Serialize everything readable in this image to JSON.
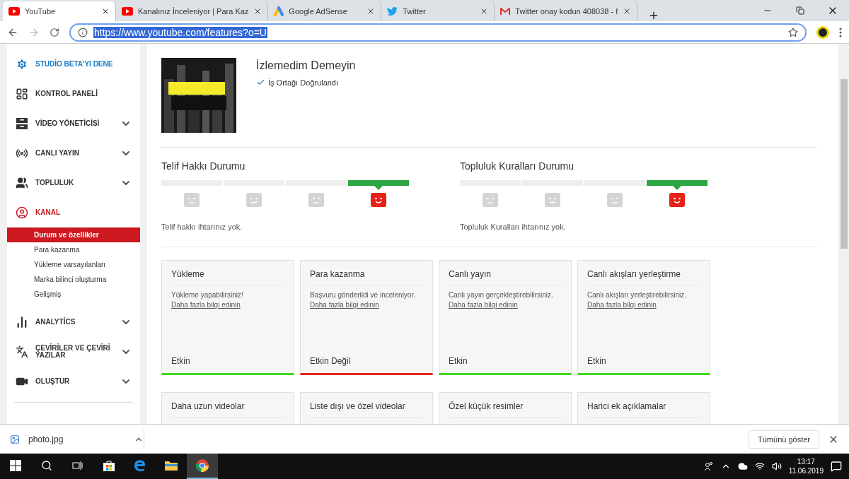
{
  "browser": {
    "tabs": [
      {
        "title": "YouTube",
        "kind": "youtube",
        "selected": true
      },
      {
        "title": "Kanalınız İnceleniyor | Para Kaz",
        "kind": "youtube",
        "selected": false
      },
      {
        "title": "Google AdSense",
        "kind": "adsense",
        "selected": false
      },
      {
        "title": "Twitter",
        "kind": "twitter",
        "selected": false
      },
      {
        "title": "Twitter onay kodun 408038 - f",
        "kind": "gmail",
        "selected": false
      }
    ],
    "address": "https://www.youtube.com/features?o=U"
  },
  "sidebar": {
    "items": [
      {
        "label": "STUDİO BETA'YI DENE",
        "kind": "promo",
        "expandable": false,
        "selected": false
      },
      {
        "label": "KONTROL PANELİ",
        "kind": "dashboard",
        "expandable": false,
        "selected": false
      },
      {
        "label": "VİDEO YÖNETİCİSİ",
        "kind": "videos",
        "expandable": true,
        "selected": false
      },
      {
        "label": "CANLI YAYIN",
        "kind": "live",
        "expandable": true,
        "selected": false
      },
      {
        "label": "TOPLULUK",
        "kind": "community",
        "expandable": true,
        "selected": false
      },
      {
        "label": "KANAL",
        "kind": "channel",
        "expandable": false,
        "selected": true,
        "children": [
          {
            "label": "Durum ve özellikler",
            "selected": true
          },
          {
            "label": "Para kazanma",
            "selected": false
          },
          {
            "label": "Yükleme varsayılanları",
            "selected": false
          },
          {
            "label": "Marka bilinci oluşturma",
            "selected": false
          },
          {
            "label": "Gelişmiş",
            "selected": false
          }
        ]
      },
      {
        "label": "ANALYTİCS",
        "kind": "analytics",
        "expandable": true,
        "selected": false
      },
      {
        "label": "ÇEVİRİLER VE ÇEVİRİ YAZILAR",
        "kind": "translate",
        "expandable": true,
        "selected": false
      },
      {
        "label": "OLUŞTUR",
        "kind": "create",
        "expandable": true,
        "selected": false
      }
    ]
  },
  "channel": {
    "name": "İzlemedim Demeyin",
    "badge": "İş Ortağı Doğrulandı"
  },
  "status_meters": [
    {
      "title": "Telif Hakkı Durumu",
      "segments": [
        {
          "kind": "frown",
          "selected": false
        },
        {
          "kind": "skew",
          "selected": false
        },
        {
          "kind": "flat",
          "selected": false
        },
        {
          "kind": "smile",
          "selected": true
        }
      ],
      "message": "Telif hakkı ihtarınız yok."
    },
    {
      "title": "Topluluk Kuralları Durumu",
      "segments": [
        {
          "kind": "frown",
          "selected": false
        },
        {
          "kind": "skew",
          "selected": false
        },
        {
          "kind": "flat",
          "selected": false
        },
        {
          "kind": "smile",
          "selected": true
        }
      ],
      "message": "Topluluk Kuralları ihtarınız yok."
    }
  ],
  "features": [
    {
      "title": "Yükleme",
      "description": "Yükleme yapabilirsiniz!",
      "link": "Daha fazla bilgi edinin",
      "status": "Etkin",
      "enabled": true
    },
    {
      "title": "Para kazanma",
      "description": "Başvuru gönderildi ve inceleniyor.",
      "link": "Daha fazla bilgi edinin",
      "status": "Etkin Değil",
      "enabled": false
    },
    {
      "title": "Canlı yayın",
      "description": "Canlı yayın gerçekleştirebilirsiniz.",
      "link": "Daha fazla bilgi edinin",
      "status": "Etkin",
      "enabled": true
    },
    {
      "title": "Canlı akışları yerleştirme",
      "description": "Canlı akışları yerleştirebilirsiniz.",
      "link": "Daha fazla bilgi edinin",
      "status": "Etkin",
      "enabled": true
    },
    {
      "title": "Daha uzun videolar"
    },
    {
      "title": "Liste dışı ve özel videolar"
    },
    {
      "title": "Özel küçük resimler"
    },
    {
      "title": "Harici ek açıklamalar"
    }
  ],
  "download_bar": {
    "file": "photo.jpg",
    "button": "Tümünü göster"
  },
  "taskbar": {
    "apps": [
      {
        "kind": "taskview",
        "selected": false
      },
      {
        "kind": "store",
        "selected": false
      },
      {
        "kind": "edge",
        "selected": false
      },
      {
        "kind": "explorer",
        "selected": false
      },
      {
        "kind": "chrome",
        "selected": true
      }
    ],
    "time": "13:17",
    "date": "11.06.2019"
  }
}
